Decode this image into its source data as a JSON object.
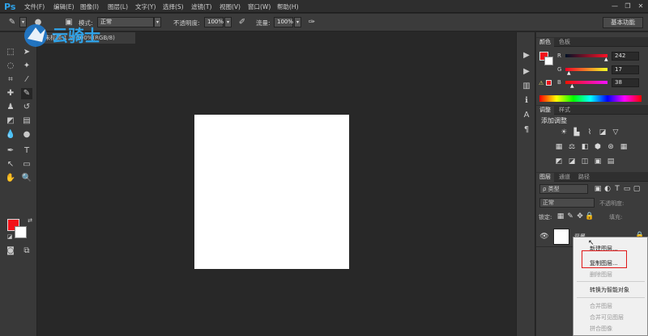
{
  "app": {
    "logo": "Ps"
  },
  "menu": [
    "文件(F)",
    "编辑(E)",
    "图像(I)",
    "图层(L)",
    "文字(Y)",
    "选择(S)",
    "滤镜(T)",
    "视图(V)",
    "窗口(W)",
    "帮助(H)"
  ],
  "window_controls": [
    "—",
    "❐",
    "✕"
  ],
  "options": {
    "mode_label": "模式:",
    "mode_value": "正常",
    "opacity_label": "不透明度:",
    "opacity_value": "100%",
    "flow_label": "流量:",
    "flow_value": "100%",
    "workspace": "基本功能"
  },
  "document": {
    "tab_title": "未标题-1 @ 100%(RGB/8)"
  },
  "watermark": {
    "text": "云骑士"
  },
  "color_panel": {
    "tabs": [
      "颜色",
      "色板"
    ],
    "r_label": "R",
    "g_label": "G",
    "b_label": "B",
    "r_value": "242",
    "g_value": "17",
    "b_value": "38",
    "foreground": "#f2111a",
    "background": "#ffffff"
  },
  "adjust_panel": {
    "tabs": [
      "调整",
      "样式"
    ],
    "title": "添加调整"
  },
  "layers_panel": {
    "tabs": [
      "图层",
      "通道",
      "路径"
    ],
    "filter_label": "ρ 类型",
    "blend_mode": "正常",
    "opacity_label": "不透明度:",
    "lock_label": "锁定:",
    "fill_label": "填充:",
    "layer_name": "背景"
  },
  "context_menu": {
    "items": [
      {
        "label": "新建图层...",
        "enabled": true
      },
      {
        "label": "复制图层...",
        "enabled": true
      },
      {
        "label": "删除图层",
        "enabled": false
      },
      {
        "label": "转换为智能对象",
        "enabled": true
      },
      {
        "label": "合并图层",
        "enabled": false
      },
      {
        "label": "合并可见图层",
        "enabled": false
      },
      {
        "label": "拼合图像",
        "enabled": false
      }
    ],
    "highlight_color": "#e01818"
  }
}
